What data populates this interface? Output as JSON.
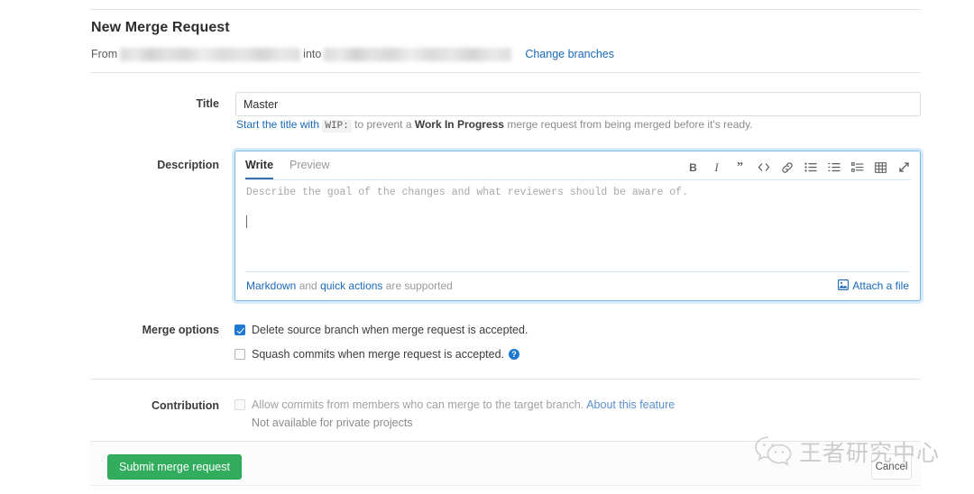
{
  "page": {
    "heading": "New Merge Request"
  },
  "branches": {
    "from_label": "From",
    "into_label": "into",
    "source_branch": "",
    "target_branch": "",
    "change_branches_link": "Change branches"
  },
  "title_field": {
    "label": "Title",
    "value": "Master",
    "placeholder": "",
    "hint_link": "Start the title with",
    "hint_code": "WIP:",
    "hint_mid": " to prevent a ",
    "hint_bold": "Work In Progress",
    "hint_end": " merge request from being merged before it's ready."
  },
  "description": {
    "label": "Description",
    "tabs": [
      {
        "label": "Write",
        "active": true
      },
      {
        "label": "Preview",
        "active": false
      }
    ],
    "toolbar": [
      {
        "name": "bold-icon",
        "glyph": "B"
      },
      {
        "name": "italic-icon",
        "glyph": "I"
      },
      {
        "name": "quote-icon",
        "glyph": "”"
      },
      {
        "name": "code-icon",
        "glyph": "</>"
      },
      {
        "name": "link-icon",
        "glyph": "🔗"
      },
      {
        "name": "bullet-list-icon",
        "glyph": "☰"
      },
      {
        "name": "numbered-list-icon",
        "glyph": "☰"
      },
      {
        "name": "task-list-icon",
        "glyph": "☰"
      },
      {
        "name": "table-icon",
        "glyph": "▦"
      },
      {
        "name": "fullscreen-icon",
        "glyph": "⤡"
      }
    ],
    "placeholder": "Describe the goal of the changes and what reviewers should be aware of.",
    "value": "",
    "footer": {
      "markdown_link": "Markdown",
      "and_text": " and ",
      "quick_actions_link": "quick actions",
      "supported_text": " are supported",
      "attach_label": "Attach a file"
    }
  },
  "merge_options": {
    "label": "Merge options",
    "items": [
      {
        "label": "Delete source branch when merge request is accepted.",
        "checked": true,
        "help": false
      },
      {
        "label": "Squash commits when merge request is accepted.",
        "checked": false,
        "help": true,
        "help_glyph": "?"
      }
    ]
  },
  "contribution": {
    "label": "Contribution",
    "checkbox_label": "Allow commits from members who can merge to the target branch.",
    "about_link": "About this feature",
    "note": "Not available for private projects",
    "checked": false,
    "disabled": true
  },
  "footer": {
    "submit_label": "Submit merge request",
    "cancel_label": "Cancel"
  },
  "watermark": {
    "text": "王者研究中心"
  },
  "colors": {
    "link": "#1b69b6",
    "submit_green": "#31ad5d",
    "checkbox_blue": "#1f78d1",
    "focus_border": "#7ab6e8"
  }
}
